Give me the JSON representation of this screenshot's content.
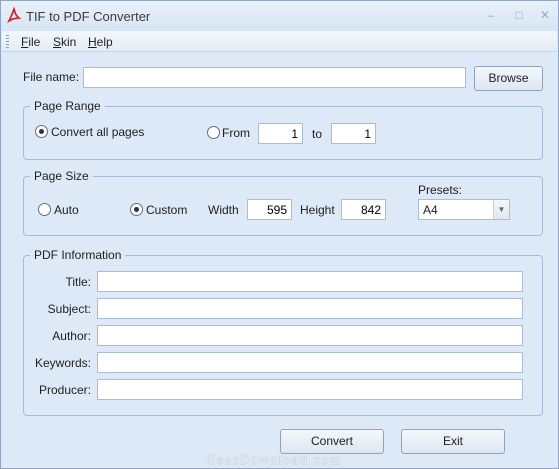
{
  "window": {
    "title": "TIF to PDF Converter"
  },
  "menu": {
    "items": [
      "File",
      "Skin",
      "Help"
    ]
  },
  "file": {
    "label": "File name:",
    "value": "",
    "browse_label": "Browse"
  },
  "page_range": {
    "title": "Page Range",
    "convert_all_label": "Convert all pages",
    "from_label": "From",
    "from_value": "1",
    "to_label": "to",
    "to_value": "1",
    "selected": "Convert all pages"
  },
  "page_size": {
    "title": "Page Size",
    "auto_label": "Auto",
    "custom_label": "Custom",
    "selected": "Custom",
    "width_label": "Width",
    "width_value": "595",
    "height_label": "Height",
    "height_value": "842",
    "presets_label": "Presets:",
    "preset_value": "A4"
  },
  "pdf_info": {
    "title": "PDF Information",
    "fields": [
      {
        "label": "Title:",
        "value": ""
      },
      {
        "label": "Subject:",
        "value": ""
      },
      {
        "label": "Author:",
        "value": ""
      },
      {
        "label": "Keywords:",
        "value": ""
      },
      {
        "label": "Producer:",
        "value": ""
      }
    ]
  },
  "actions": {
    "convert_label": "Convert",
    "exit_label": "Exit"
  },
  "watermark": "GearDownload.com",
  "colors": {
    "window_bg": "#dde9f6",
    "border": "#a5bbd4",
    "pdf_icon": "#d4161c"
  }
}
